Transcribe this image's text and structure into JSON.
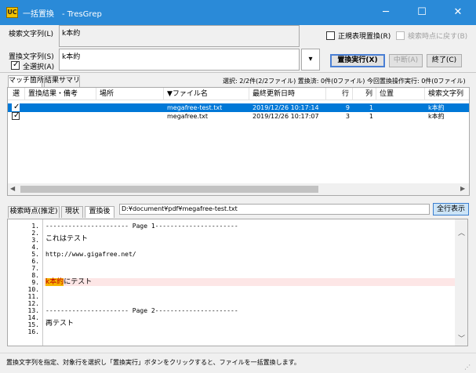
{
  "window": {
    "app_icon_text": "UC",
    "title": "一括置換　- TresGrep",
    "minimize": "─",
    "maximize": "☐",
    "close": "✕"
  },
  "search": {
    "search_label": "検索文字列(L)",
    "search_value": "k本約",
    "replace_label": "置換文字列(S)",
    "replace_value": "k本約",
    "select_all_label": "全選択(A)",
    "select_all_checked": true,
    "dropdown_arrow": "▾"
  },
  "options": {
    "regex_label": "正規表現置換(R)",
    "regex_checked": false,
    "revert_label": "検索時点に戻す(B)",
    "revert_checked": false
  },
  "buttons": {
    "execute": "置換実行(X)",
    "abort": "中断(A)",
    "finish": "終了(C)",
    "show_all_rows": "全行表示"
  },
  "upper_tabs": {
    "tab1": "マッチ箇所",
    "tab2": "結果サマリ"
  },
  "summary": {
    "text": "選択: 2/2件(2/2ファイル)  置換済: 0件(0ファイル)  今回置換操作実行: 0件(0ファイル)"
  },
  "table": {
    "headers": {
      "check": "選",
      "result": "置換結果・備考",
      "place": "場所",
      "filename": "▼ファイル名",
      "modified": "最終更新日時",
      "line": "行",
      "col": "列",
      "pos": "位置",
      "searchstr": "検索文字列"
    },
    "rows": [
      {
        "checked": true,
        "result": "",
        "place": "",
        "filename": "megafree-test.txt",
        "modified": "2019/12/26 10:17:14",
        "line": "9",
        "col": "1",
        "pos": "",
        "searchstr": "k本約"
      },
      {
        "checked": true,
        "result": "",
        "place": "",
        "filename": "megafree.txt",
        "modified": "2019/12/26 10:17:07",
        "line": "3",
        "col": "1",
        "pos": "",
        "searchstr": "k本約"
      }
    ]
  },
  "lower_tabs": {
    "tab1": "検索時点(推定)",
    "tab2": "現状",
    "tab3": "置換後"
  },
  "preview": {
    "path": "D:¥document¥pdf¥megafree-test.txt",
    "line_numbers": [
      "1.",
      "2.",
      "3.",
      "4.",
      "5.",
      "6.",
      "7.",
      "8.",
      "9.",
      "10.",
      "11.",
      "12.",
      "13.",
      "14.",
      "15.",
      "16."
    ],
    "page1_header": "---------------------- Page 1----------------------",
    "line3": "これはテスト",
    "line5": "http://www.gigafree.net/",
    "line9_match": "k本約",
    "line9_rest": "にテスト",
    "page2_header": "---------------------- Page 2----------------------",
    "line14": "再テスト"
  },
  "status": {
    "text": "置換文字列を指定、対象行を選択し「置換実行」ボタンをクリックすると、ファイルを一括置換します。"
  }
}
